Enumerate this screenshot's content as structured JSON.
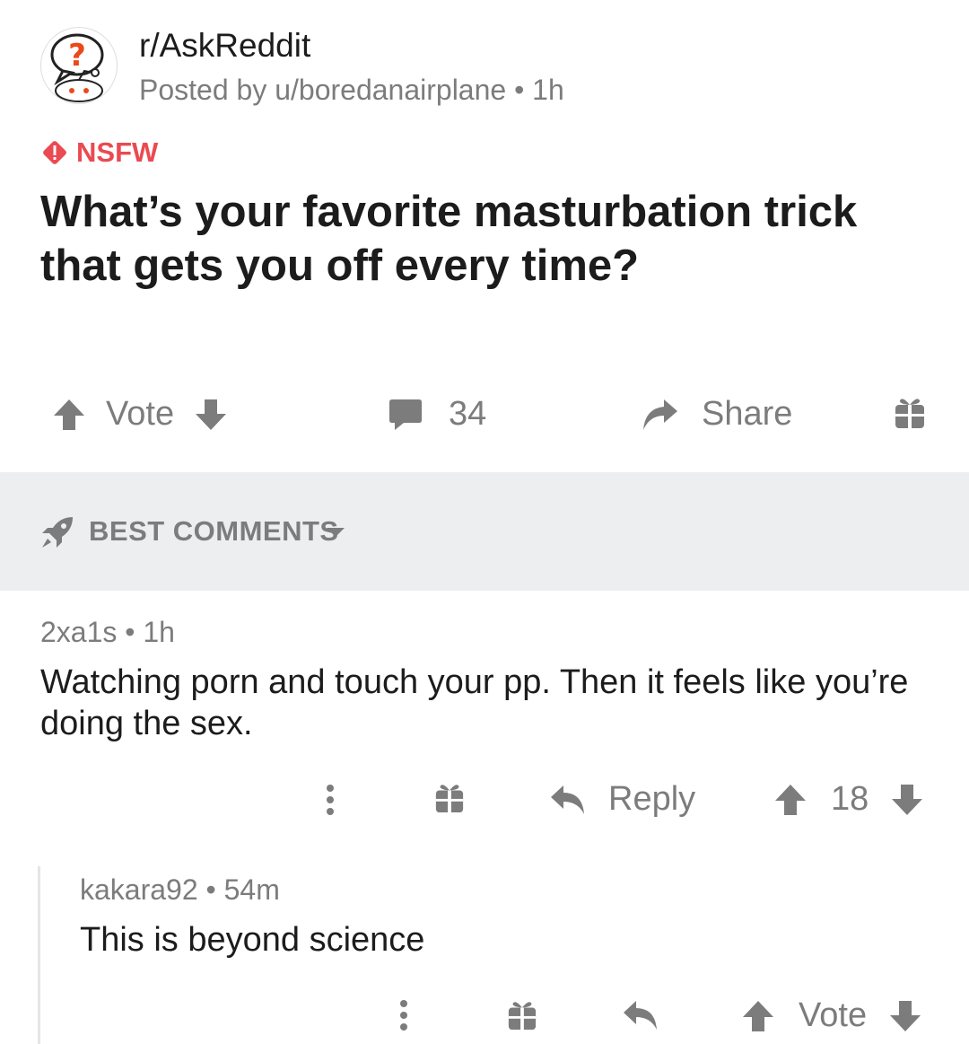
{
  "post": {
    "subreddit": "r/AskReddit",
    "byline": "Posted by u/boredanairplane • 1h",
    "nsfw_label": "NSFW",
    "title": "What’s your favorite masturbation trick that gets you off every time?",
    "actions": {
      "vote_label": "Vote",
      "comment_count": "34",
      "share_label": "Share"
    }
  },
  "comments_section": {
    "sort_label": "BEST COMMENTS"
  },
  "comments": [
    {
      "meta": "2xa1s • 1h",
      "text": "Watching porn and touch your pp. Then it feels like you’re doing the sex.",
      "reply_label": "Reply",
      "score": "18"
    },
    {
      "meta": "kakara92 • 54m",
      "text": "This is beyond science",
      "vote_label": "Vote"
    }
  ],
  "icons": [
    "subreddit-avatar-icon",
    "warning-icon",
    "upvote-icon",
    "downvote-icon",
    "comment-icon",
    "share-icon",
    "gift-icon",
    "rocket-icon",
    "caret-down-icon",
    "more-icon",
    "reply-icon"
  ],
  "colors": {
    "nsfw": "#ea4a52",
    "icon_gray": "#7c7c7c",
    "bar_bg": "#edeef0"
  }
}
